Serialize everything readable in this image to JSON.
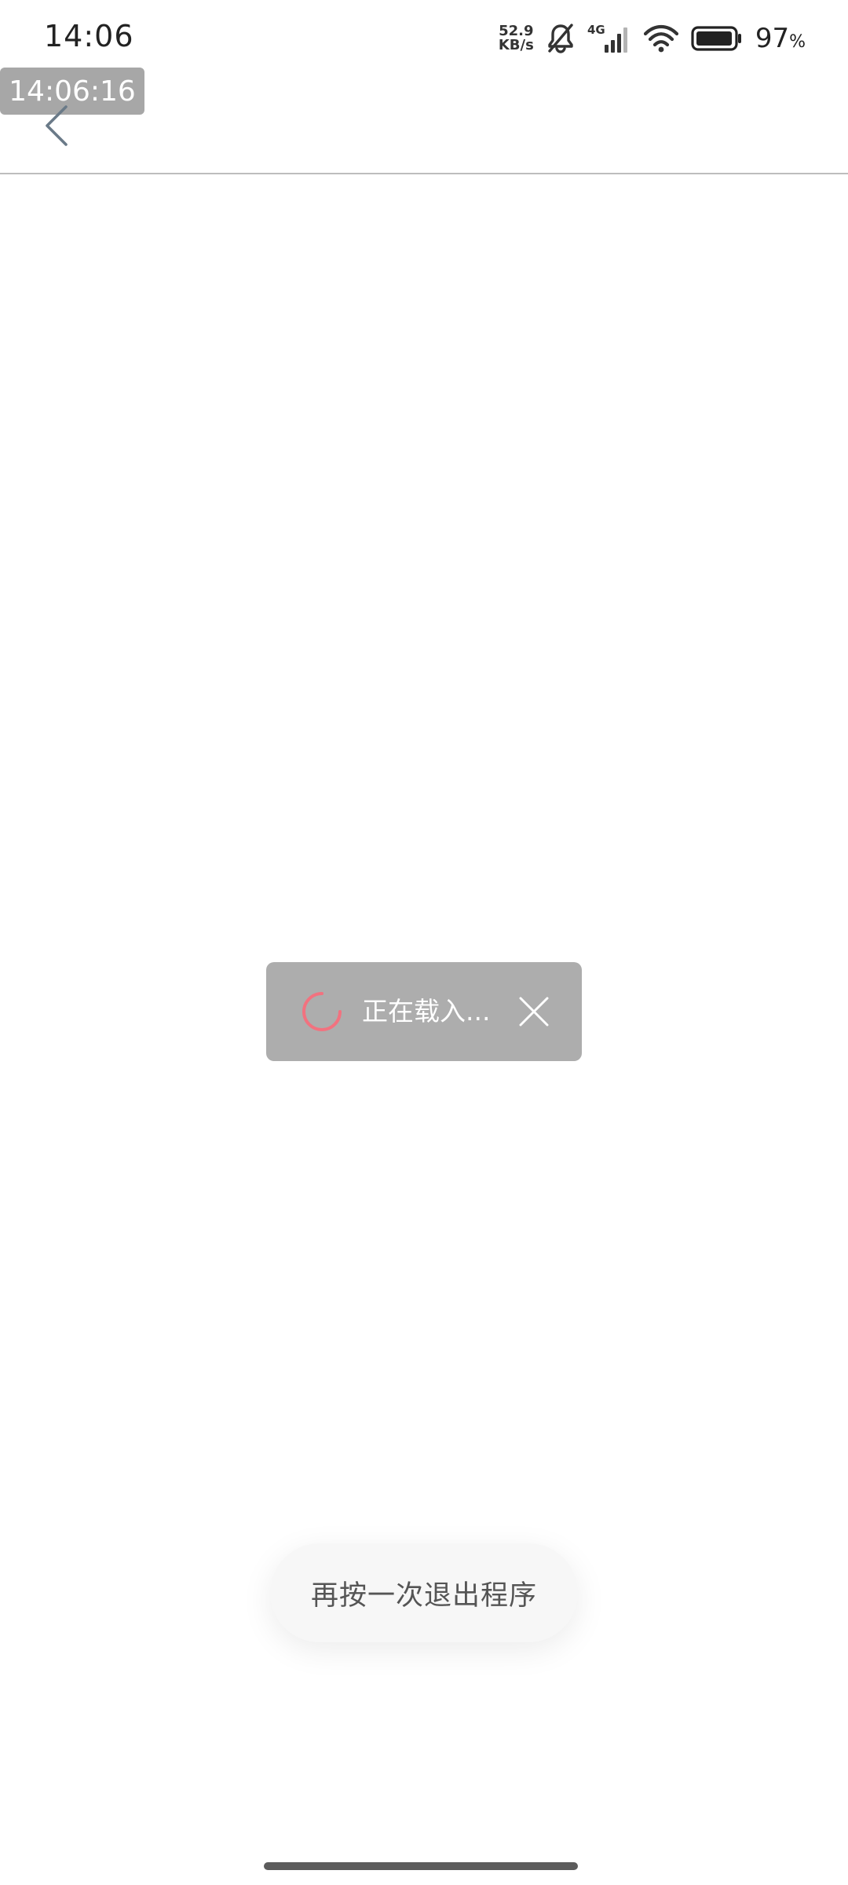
{
  "status_bar": {
    "time": "14:06",
    "net_speed_value": "52.9",
    "net_speed_unit": "KB/s",
    "network_type": "4G",
    "battery_percent": "97",
    "battery_unit": "%",
    "icons": [
      "bell-muted-icon",
      "signal-icon",
      "wifi-icon",
      "battery-icon"
    ]
  },
  "overlay": {
    "timestamp": "14:06:16"
  },
  "nav": {
    "back_icon": "chevron-left-icon"
  },
  "loading_toast": {
    "text": "正在载入...",
    "spinner_color": "#f2727f",
    "close_icon": "close-icon"
  },
  "exit_toast": {
    "text": "再按一次退出程序"
  }
}
